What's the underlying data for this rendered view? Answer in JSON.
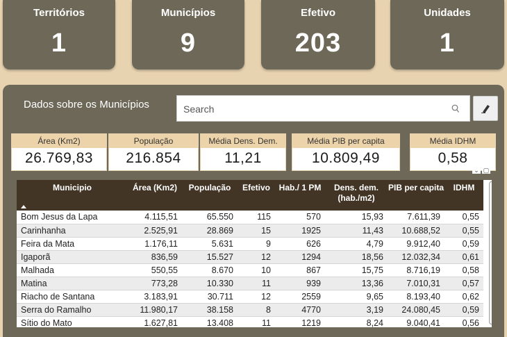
{
  "kpis": [
    {
      "label": "Territórios",
      "value": "1"
    },
    {
      "label": "Municípios",
      "value": "9"
    },
    {
      "label": "Efetivo",
      "value": "203"
    },
    {
      "label": "Unidades",
      "value": "1"
    }
  ],
  "panel": {
    "title": "Dados sobre os Municípios",
    "search_placeholder": "Search"
  },
  "metrics": [
    {
      "label": "Área (Km2)",
      "value": "26.769,83"
    },
    {
      "label": "População",
      "value": "216.854"
    },
    {
      "label": "Média Dens. Dem.",
      "value": "11,21"
    },
    {
      "label": "Média PIB per capita",
      "value": "10.809,49"
    },
    {
      "label": "Média IDHM",
      "value": "0,58"
    }
  ],
  "table": {
    "headers": [
      "Municipio",
      "Área (Km2)",
      "População",
      "Efetivo",
      "Hab./ 1 PM",
      "Dens. dem. (hab./m2)",
      "PIB per capita",
      "IDHM"
    ],
    "rows": [
      [
        "Bom Jesus da Lapa",
        "4.115,51",
        "65.550",
        "115",
        "570",
        "15,93",
        "7.611,39",
        "0,55"
      ],
      [
        "Carinhanha",
        "2.525,91",
        "28.869",
        "15",
        "1925",
        "11,43",
        "10.688,52",
        "0,55"
      ],
      [
        "Feira da Mata",
        "1.176,11",
        "5.631",
        "9",
        "626",
        "4,79",
        "9.912,40",
        "0,59"
      ],
      [
        "Igaporã",
        "836,59",
        "15.527",
        "12",
        "1294",
        "18,56",
        "12.032,34",
        "0,61"
      ],
      [
        "Malhada",
        "550,55",
        "8.670",
        "10",
        "867",
        "15,75",
        "8.716,19",
        "0,58"
      ],
      [
        "Matina",
        "773,28",
        "10.330",
        "11",
        "939",
        "13,36",
        "7.010,31",
        "0,57"
      ],
      [
        "Riacho de Santana",
        "3.183,91",
        "30.711",
        "12",
        "2559",
        "9,65",
        "8.193,40",
        "0,62"
      ],
      [
        "Serra do Ramalho",
        "11.980,17",
        "38.158",
        "8",
        "4770",
        "3,19",
        "24.080,45",
        "0,59"
      ],
      [
        "Sítio do Mato",
        "1.627,81",
        "13.408",
        "11",
        "1219",
        "8,24",
        "9.040,41",
        "0,56"
      ]
    ]
  }
}
